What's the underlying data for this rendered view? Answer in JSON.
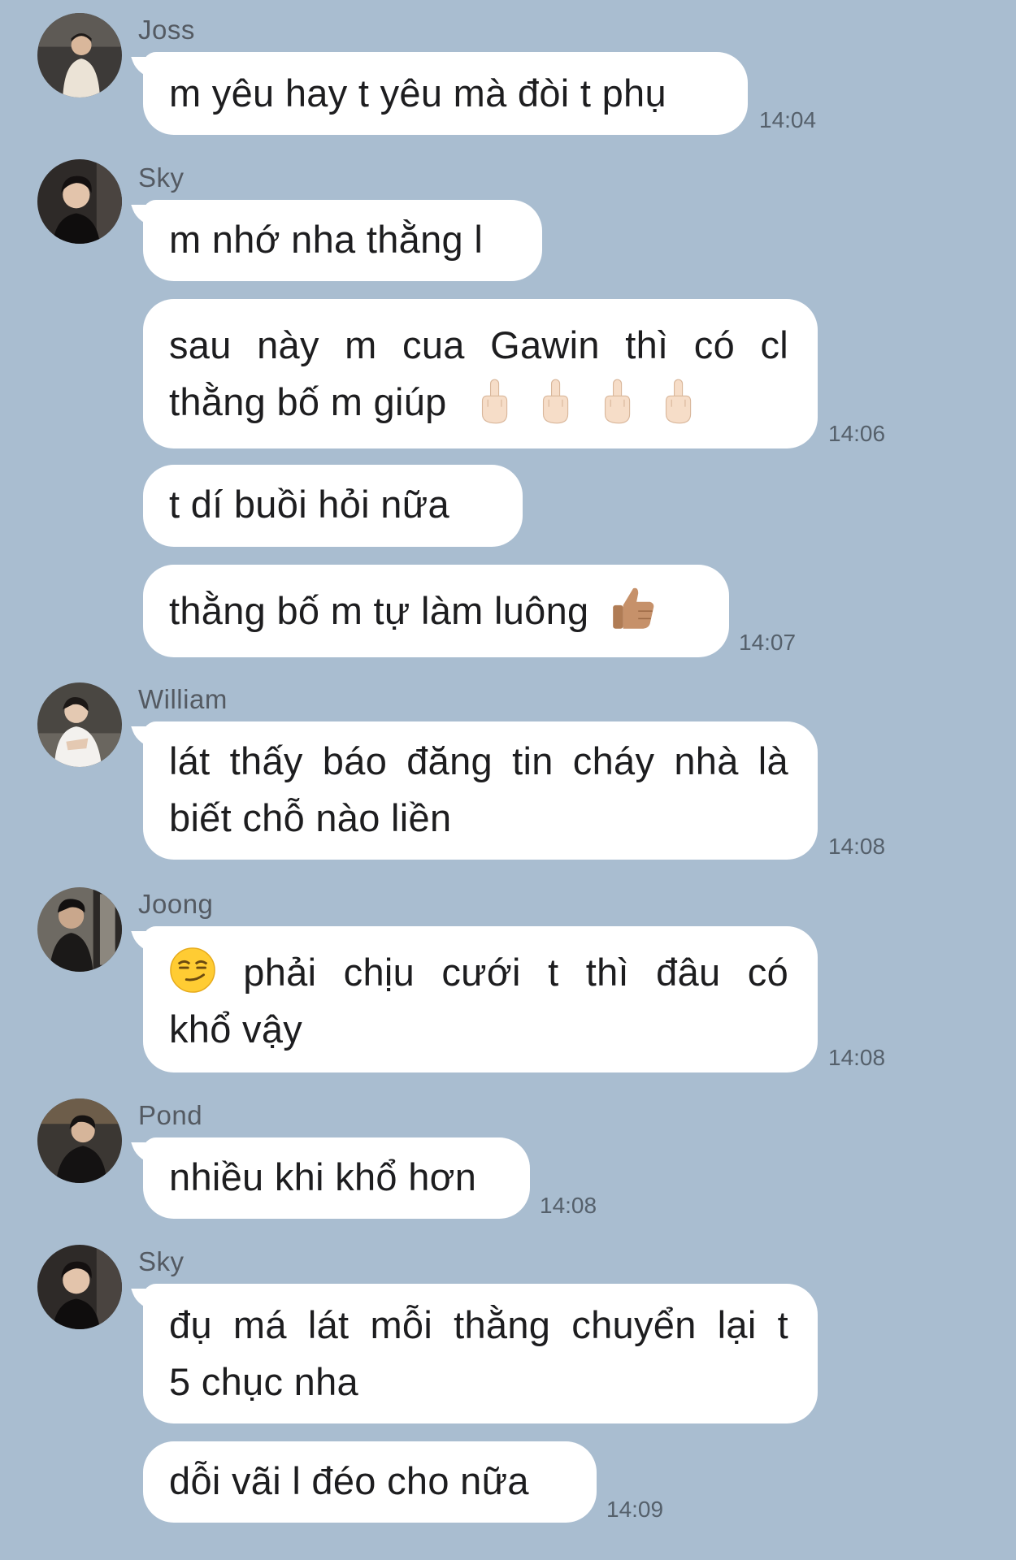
{
  "messages": [
    {
      "sender": "Joss",
      "avatar": "avatar-joss",
      "bubbles": [
        {
          "text": "m yêu hay t yêu mà đòi t phụ",
          "time": "14:04"
        }
      ]
    },
    {
      "sender": "Sky",
      "avatar": "avatar-sky",
      "bubbles": [
        {
          "text": "m nhớ nha thằng l"
        },
        {
          "lines": [
            "sau này m cua Gawin thì có cl",
            "thằng bố m giúp"
          ],
          "emoji": "middle-finger x4",
          "time": "14:06"
        },
        {
          "text": "t dí buồi hỏi nữa"
        },
        {
          "text": "thằng bố m tự làm luông",
          "emoji": "thumbs-up",
          "time": "14:07"
        }
      ]
    },
    {
      "sender": "William",
      "avatar": "avatar-william",
      "bubbles": [
        {
          "lines": [
            "lát thấy báo đăng tin cháy nhà là",
            "biết chỗ nào liền"
          ],
          "time": "14:08"
        }
      ]
    },
    {
      "sender": "Joong",
      "avatar": "avatar-joong",
      "bubbles": [
        {
          "lines": [
            "phải chịu cưới t thì đâu có",
            "khổ vậy"
          ],
          "emoji": "smirk",
          "time": "14:08"
        }
      ]
    },
    {
      "sender": "Pond",
      "avatar": "avatar-pond",
      "bubbles": [
        {
          "text": "nhiều khi khổ hơn",
          "time": "14:08"
        }
      ]
    },
    {
      "sender": "Sky",
      "avatar": "avatar-sky",
      "bubbles": [
        {
          "lines": [
            "đụ má lát mỗi thằng chuyển lại t",
            "5 chục nha"
          ]
        },
        {
          "text": "dỗi vãi l đéo cho nữa",
          "time": "14:09"
        }
      ]
    }
  ],
  "colors": {
    "background": "#a9bdd0",
    "bubble": "#ffffff",
    "sender_name": "#545a62",
    "timestamp": "#55606b"
  }
}
